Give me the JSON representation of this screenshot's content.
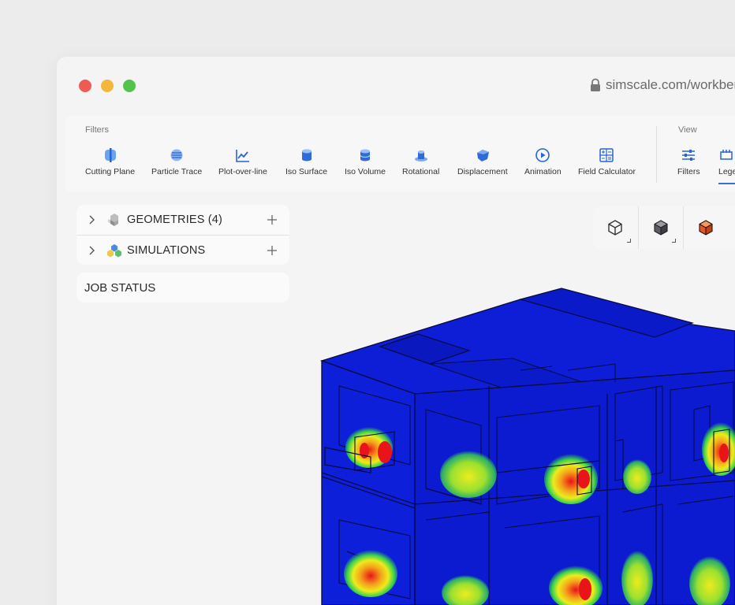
{
  "browser": {
    "url": "simscale.com/workben",
    "traffic_lights": [
      "close",
      "minimize",
      "zoom"
    ],
    "colors": {
      "close": "#ee5b55",
      "minimize": "#f4b73a",
      "zoom": "#54c34b"
    }
  },
  "toolbar": {
    "filters_label": "Filters",
    "view_label": "View",
    "filters": [
      {
        "label": "Cutting Plane",
        "icon": "cutting-plane-icon"
      },
      {
        "label": "Particle Trace",
        "icon": "particle-trace-icon"
      },
      {
        "label": "Plot-over-line",
        "icon": "plot-over-line-icon"
      },
      {
        "label": "Iso Surface",
        "icon": "iso-surface-icon"
      },
      {
        "label": "Iso Volume",
        "icon": "iso-volume-icon"
      },
      {
        "label": "Rotational",
        "icon": "rotational-icon"
      },
      {
        "label": "Displacement",
        "icon": "displacement-icon"
      },
      {
        "label": "Animation",
        "icon": "animation-icon"
      },
      {
        "label": "Field Calculator",
        "icon": "field-calculator-icon"
      }
    ],
    "view": [
      {
        "label": "Filters",
        "icon": "sliders-icon"
      },
      {
        "label": "Lege",
        "icon": "legend-icon",
        "active": true
      }
    ],
    "accent": "#3a70d8"
  },
  "tree": {
    "geometries": {
      "label": "GEOMETRIES",
      "count": "(4)"
    },
    "simulations": {
      "label": "SIMULATIONS"
    },
    "job_status": "JOB STATUS"
  },
  "view_cubes": [
    "wireframe-cube-icon",
    "solid-cube-icon",
    "orientation-cube-icon"
  ],
  "result_colors": {
    "low": "#0a1fd8",
    "mid": "#38d44a",
    "high": "#e8141a"
  }
}
